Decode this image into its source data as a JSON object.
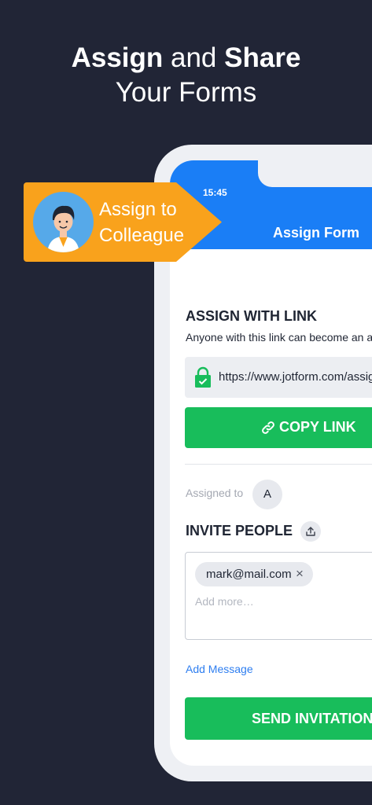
{
  "promo": {
    "headline_bold_1": "Assign",
    "headline_mid": " and ",
    "headline_bold_2": "Share",
    "headline_line2": "Your Forms"
  },
  "badge": {
    "line1": "Assign to",
    "line2": "Colleague",
    "color": "#f9a21c",
    "avatar_icon": "person-avatar-icon"
  },
  "status_bar": {
    "time": "15:45"
  },
  "app_bar": {
    "title": "Assign Form",
    "color": "#1a7ef6"
  },
  "assign_link": {
    "title": "ASSIGN WITH LINK",
    "description": "Anyone with this link can become an assignee",
    "url": "https://www.jotform.com/assign/form",
    "lock_icon": "lock-icon",
    "copy_label": "COPY LINK",
    "copy_icon": "link-icon"
  },
  "assigned": {
    "label": "Assigned to",
    "avatar_initial": "A"
  },
  "invite": {
    "title": "INVITE PEOPLE",
    "upload_icon": "upload-icon",
    "chips": [
      {
        "email": "mark@mail.com",
        "remove": "×"
      }
    ],
    "placeholder": "Add more…",
    "add_message": "Add Message",
    "send_label": "SEND INVITATION"
  },
  "colors": {
    "background": "#212536",
    "green": "#18bd5b",
    "link_blue": "#2e7ef0"
  }
}
